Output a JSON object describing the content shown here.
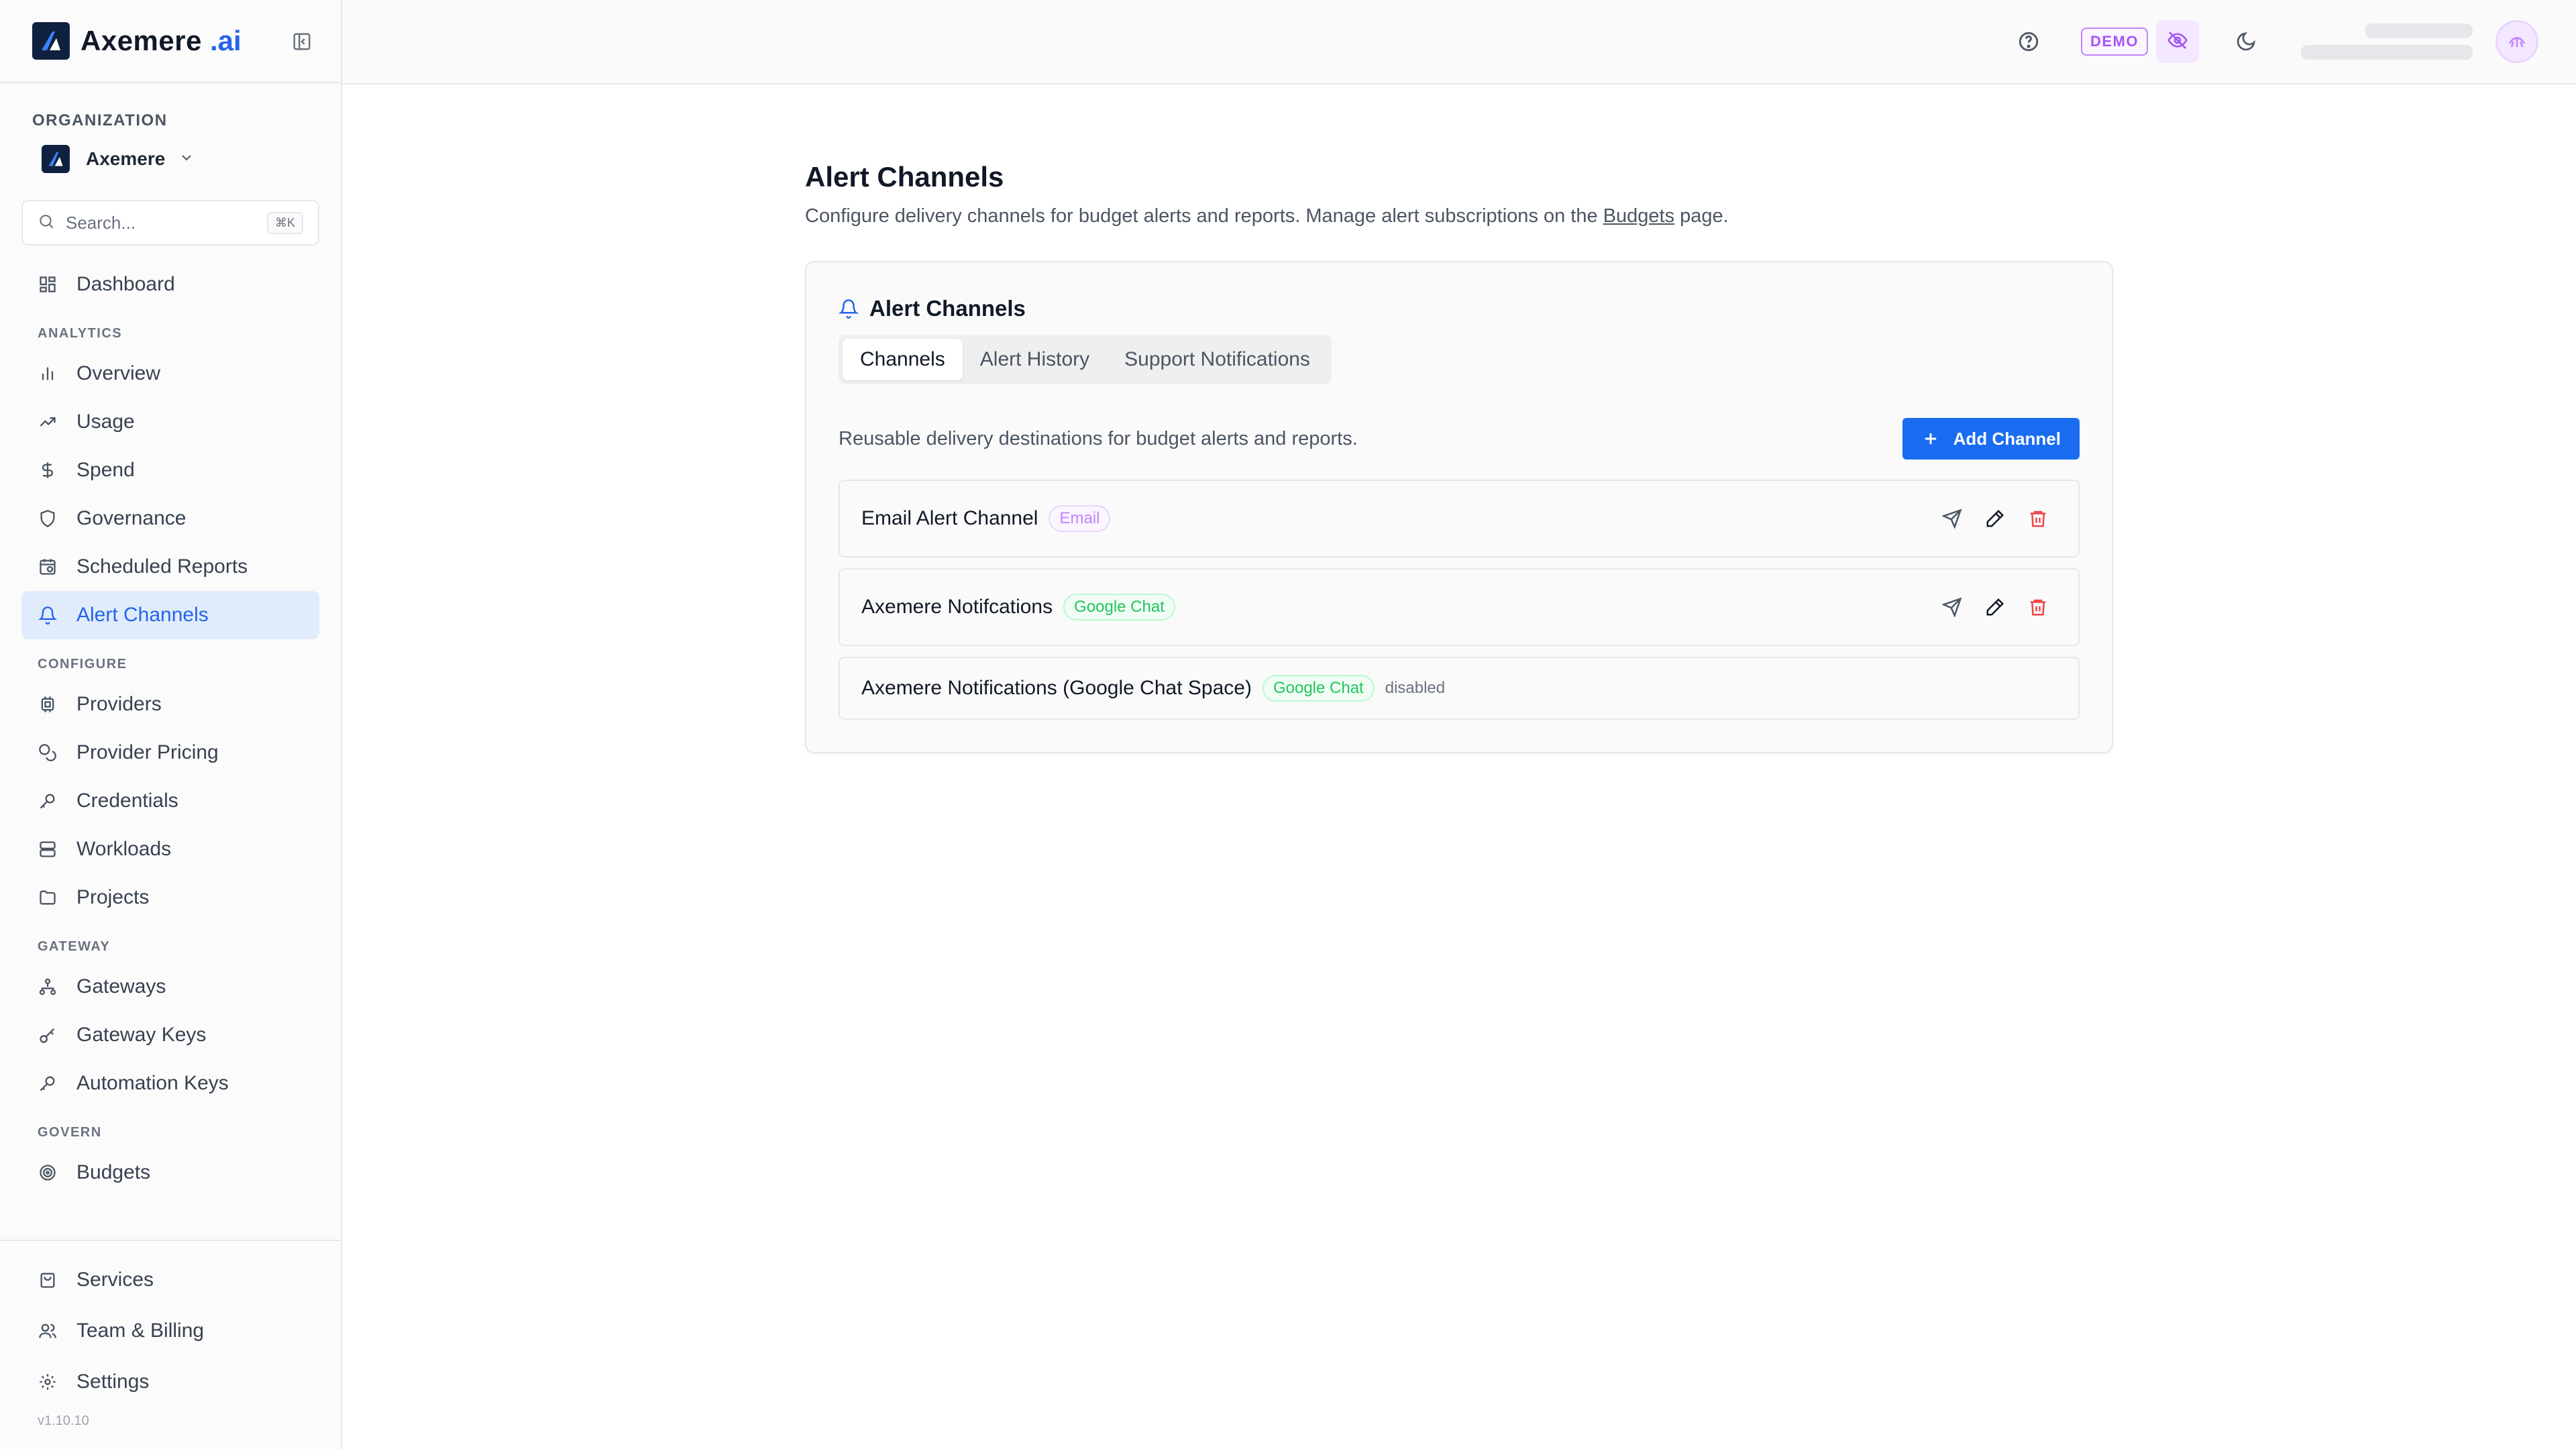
{
  "brand": {
    "name": "Axemere",
    "suffix": ".ai"
  },
  "org": {
    "label": "ORGANIZATION",
    "name": "Axemere"
  },
  "search": {
    "placeholder": "Search...",
    "shortcut": "⌘K"
  },
  "sidebar": {
    "dashboard": "Dashboard",
    "sections": {
      "analytics": "ANALYTICS",
      "configure": "CONFIGURE",
      "gateway": "GATEWAY",
      "govern": "GOVERN"
    },
    "analytics": [
      "Overview",
      "Usage",
      "Spend",
      "Governance",
      "Scheduled Reports",
      "Alert Channels"
    ],
    "configure": [
      "Providers",
      "Provider Pricing",
      "Credentials",
      "Workloads",
      "Projects"
    ],
    "gateway": [
      "Gateways",
      "Gateway Keys",
      "Automation Keys"
    ],
    "govern": [
      "Budgets"
    ],
    "bottom": [
      "Services",
      "Team & Billing",
      "Settings"
    ],
    "version": "v1.10.10",
    "active": "Alert Channels"
  },
  "topbar": {
    "demo": "DEMO"
  },
  "page": {
    "title": "Alert Channels",
    "desc_before": "Configure delivery channels for budget alerts and reports. Manage alert subscriptions on the ",
    "desc_link": "Budgets",
    "desc_after": " page."
  },
  "card": {
    "title": "Alert Channels",
    "tabs": [
      "Channels",
      "Alert History",
      "Support Notifications"
    ],
    "active_tab": "Channels",
    "description": "Reusable delivery destinations for budget alerts and reports.",
    "add_button": "Add Channel",
    "channels": [
      {
        "name": "Email Alert Channel",
        "type": "Email",
        "status": ""
      },
      {
        "name": "Axemere Notifcations",
        "type": "Google Chat",
        "status": ""
      },
      {
        "name": "Axemere Notifications (Google Chat Space)",
        "type": "Google Chat",
        "status": "disabled"
      }
    ]
  },
  "colors": {
    "accent": "#2563eb",
    "button": "#1a6cf0",
    "danger": "#ef4444",
    "email_badge": "#c084fc",
    "gchat_badge": "#22c55e"
  },
  "icons": {
    "send": "send-icon",
    "edit": "pencil-icon",
    "delete": "trash-icon"
  }
}
